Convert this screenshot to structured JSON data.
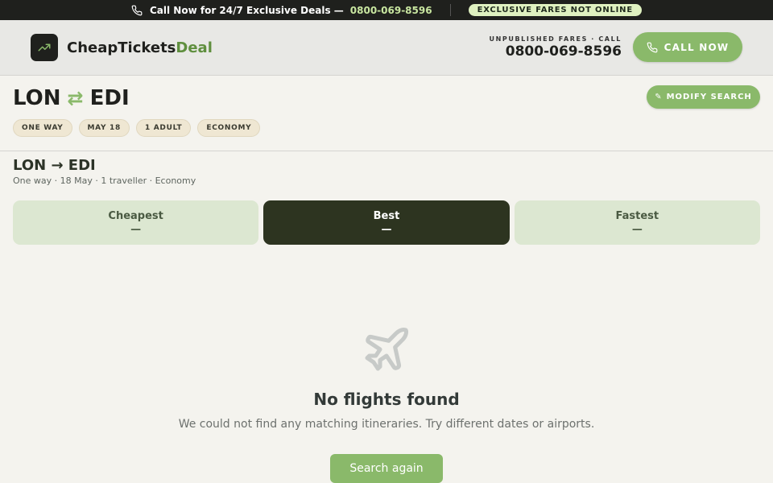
{
  "promo": {
    "text": "Call Now for 24/7 Exclusive Deals —",
    "phone": "0800-069-8596",
    "badge": "EXCLUSIVE FARES NOT ONLINE"
  },
  "header": {
    "brand_main": "CheapTickets",
    "brand_accent": "Deal",
    "contact_label": "UNPUBLISHED FARES · CALL",
    "contact_phone": "0800-069-8596",
    "call_button": "CALL NOW"
  },
  "route": {
    "origin": "LON",
    "swap_symbol": "⇄",
    "destination": "EDI",
    "modify_button": "MODIFY SEARCH",
    "chips": [
      "ONE WAY",
      "MAY 18",
      "1 ADULT",
      "ECONOMY"
    ]
  },
  "summary": {
    "title": "LON → EDI",
    "subtitle": "One way · 18 May · 1 traveller · Economy"
  },
  "tabs": [
    {
      "label": "Cheapest",
      "value": "—",
      "active": false
    },
    {
      "label": "Best",
      "value": "—",
      "active": true
    },
    {
      "label": "Fastest",
      "value": "—",
      "active": false
    }
  ],
  "empty": {
    "icon": "airplane-icon",
    "heading": "No flights found",
    "message": "We could not find any matching itineraries. Try different dates or airports.",
    "button": "Search again"
  },
  "colors": {
    "accent": "#8ab96a",
    "dark": "#1f201d",
    "active_tab": "#2d3420"
  }
}
